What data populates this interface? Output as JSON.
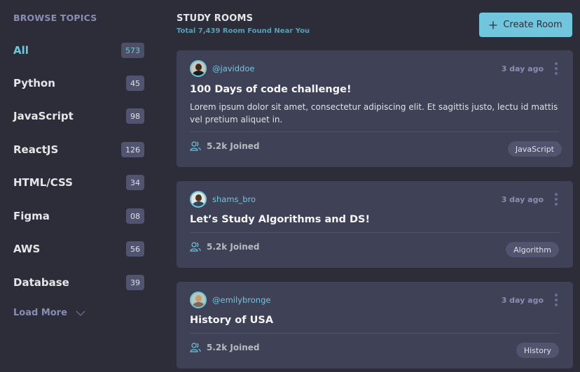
{
  "sidebar": {
    "heading": "BROWSE TOPICS",
    "topics": [
      {
        "label": "All",
        "count": "573"
      },
      {
        "label": "Python",
        "count": "45"
      },
      {
        "label": "JavaScript",
        "count": "98"
      },
      {
        "label": "ReactJS",
        "count": "126"
      },
      {
        "label": "HTML/CSS",
        "count": "34"
      },
      {
        "label": "Figma",
        "count": "08"
      },
      {
        "label": "AWS",
        "count": "56"
      },
      {
        "label": "Database",
        "count": "39"
      }
    ],
    "load_more": "Load More"
  },
  "header": {
    "title": "STUDY ROOMS",
    "subtitle": "Total 7,439 Room Found Near You",
    "create_label": "Create Room"
  },
  "rooms": [
    {
      "host": "@javiddoe",
      "time": "3 day ago",
      "title": "100 Days of code challenge!",
      "description": "Lorem ipsum dolor sit amet, consectetur adipiscing elit. Et sagittis justo, lectu id mattis vel pretium aliquet in.",
      "joined": "5.2k Joined",
      "tag": "JavaScript"
    },
    {
      "host": "shams_bro",
      "time": "3 day ago",
      "title": "Let’s Study Algorithms and DS!",
      "joined": "5.2k Joined",
      "tag": "Algorithm"
    },
    {
      "host": "@emilybronge",
      "time": "3 day ago",
      "title": "History of USA",
      "joined": "5.2k Joined",
      "tag": "History"
    }
  ],
  "colors": {
    "background": "#2d2d39",
    "card": "#3f4156",
    "accent": "#71c6dd",
    "muted": "#8a8eb4"
  }
}
